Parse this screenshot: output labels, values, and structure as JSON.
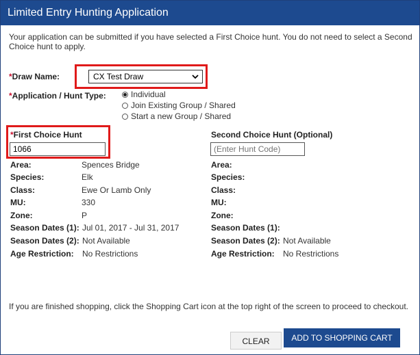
{
  "title": "Limited Entry Hunting Application",
  "intro": "Your application can be submitted if you have selected a First Choice hunt. You do not need to select a Second Choice hunt to apply.",
  "required_mark": "*",
  "draw": {
    "label": "Draw Name:",
    "value": "CX Test Draw"
  },
  "hunt_type": {
    "label": "Application / Hunt Type:",
    "options": [
      "Individual",
      "Join Existing Group / Shared",
      "Start a new Group / Shared"
    ],
    "selected": "Individual"
  },
  "first": {
    "label": "First Choice Hunt",
    "value": "1066",
    "fields": [
      {
        "label": "Area:",
        "value": "Spences Bridge"
      },
      {
        "label": "Species:",
        "value": "Elk"
      },
      {
        "label": "Class:",
        "value": "Ewe Or Lamb Only"
      },
      {
        "label": "MU:",
        "value": "330"
      },
      {
        "label": "Zone:",
        "value": "P"
      },
      {
        "label": "Season Dates (1):",
        "value": "Jul 01, 2017 - Jul 31, 2017"
      },
      {
        "label": "Season Dates (2):",
        "value": "Not Available"
      },
      {
        "label": "Age Restriction:",
        "value": "No Restrictions"
      }
    ]
  },
  "second": {
    "label": "Second Choice Hunt (Optional)",
    "placeholder": "(Enter Hunt Code)",
    "fields": [
      {
        "label": "Area:",
        "value": ""
      },
      {
        "label": "Species:",
        "value": ""
      },
      {
        "label": "Class:",
        "value": ""
      },
      {
        "label": "MU:",
        "value": ""
      },
      {
        "label": "Zone:",
        "value": ""
      },
      {
        "label": "Season Dates (1):",
        "value": ""
      },
      {
        "label": "Season Dates (2):",
        "value": "Not Available"
      },
      {
        "label": "Age Restriction:",
        "value": "No Restrictions"
      }
    ]
  },
  "footer_note": "If you are finished shopping, click the Shopping Cart icon at the top right of the screen to proceed to checkout.",
  "buttons": {
    "clear": "CLEAR",
    "add": "ADD TO SHOPPING CART"
  },
  "colors": {
    "header": "#1d4a8f",
    "highlight": "#e01a1a",
    "required": "#c8102e"
  }
}
